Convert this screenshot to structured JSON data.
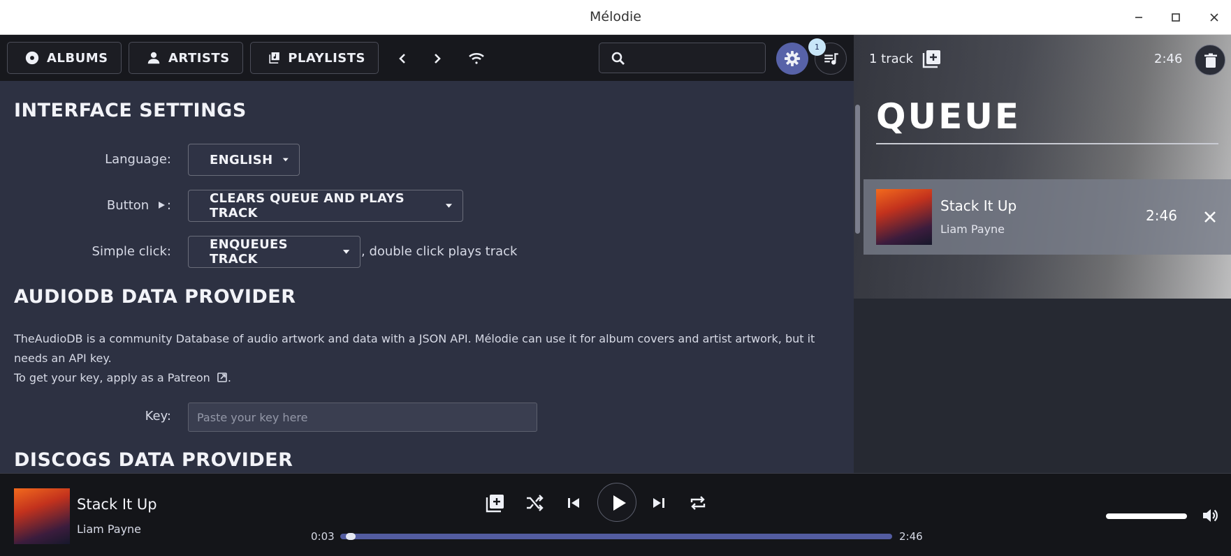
{
  "window": {
    "title": "Mélodie"
  },
  "nav": {
    "albums": "ALBUMS",
    "artists": "ARTISTS",
    "playlists": "PLAYLISTS",
    "search_placeholder": "",
    "queue_badge": "1"
  },
  "interface": {
    "heading": "INTERFACE SETTINGS",
    "language_label": "Language:",
    "language_value": "ENGLISH",
    "button_label": "Button",
    "button_label_suffix": ":",
    "button_value": "CLEARS QUEUE AND PLAYS TRACK",
    "click_label": "Simple click:",
    "click_value": "ENQUEUES TRACK",
    "click_suffix": ", double click plays track"
  },
  "audiodb": {
    "heading": "AUDIODB DATA PROVIDER",
    "description": "TheAudioDB is a community Database of audio artwork and data with a JSON API. Mélodie can use it for album covers and artist artwork, but it needs an API key.",
    "patreon_text": "To get your key, apply as a Patreon",
    "patreon_end": ".",
    "key_label": "Key:",
    "key_placeholder": "Paste your key here"
  },
  "discogs": {
    "heading": "DISCOGS DATA PROVIDER"
  },
  "queue": {
    "count": "1 track",
    "total_duration": "2:46",
    "title": "QUEUE",
    "items": [
      {
        "title": "Stack It Up",
        "artist": "Liam Payne",
        "duration": "2:46"
      }
    ]
  },
  "player": {
    "title": "Stack It Up",
    "artist": "Liam Payne",
    "elapsed": "0:03",
    "total": "2:46",
    "progress": 0.018,
    "volume": 1.0
  },
  "icons": {
    "albums": "disc-icon",
    "artists": "person-icon",
    "playlists": "playlist-icon",
    "settings": "gear-icon",
    "queue": "queue-music-icon",
    "connection": "wifi-icon"
  },
  "colors": {
    "accent": "#5762a8",
    "content_bg": "#2d3142",
    "topbar_bg": "#17181d"
  }
}
